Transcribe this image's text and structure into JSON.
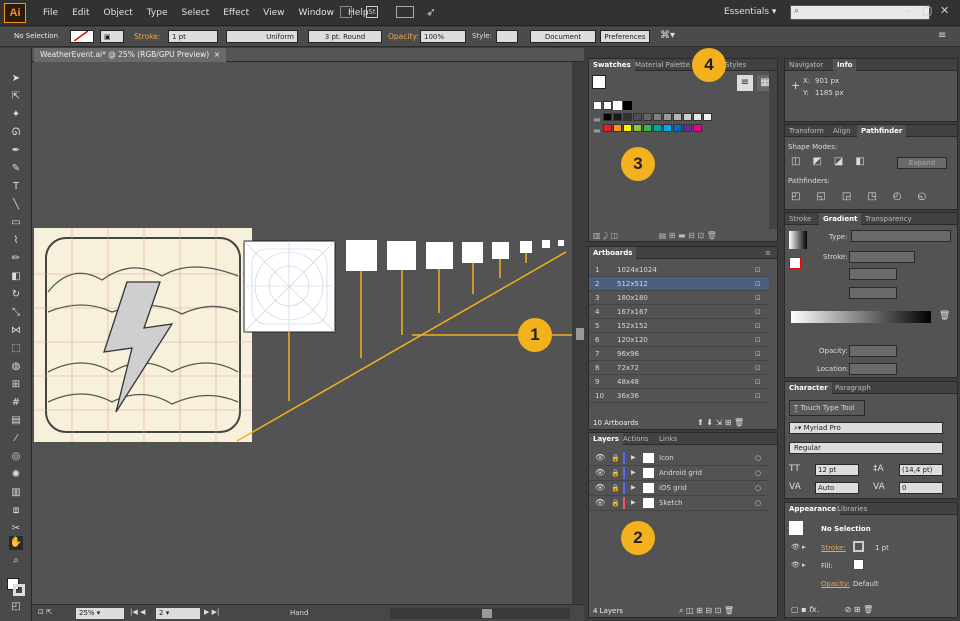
{
  "app": {
    "logo": "Ai"
  },
  "menu": [
    "File",
    "Edit",
    "Object",
    "Type",
    "Select",
    "Effect",
    "View",
    "Window",
    "Help"
  ],
  "workspace": "Essentials",
  "control_bar": {
    "selection": "No Selection",
    "stroke_label": "Stroke:",
    "stroke_value": "1 pt",
    "profile": "Uniform",
    "brush": "3 pt. Round",
    "opacity_label": "Opacity:",
    "opacity_value": "100%",
    "style_label": "Style:",
    "doc_setup": "Document Setup",
    "preferences": "Preferences"
  },
  "document_tab": "WeatherEvent.ai* @ 25% (RGB/GPU Preview)",
  "status_bar": {
    "zoom": "25%",
    "artboard": "2",
    "tool": "Hand"
  },
  "swatches_panel": {
    "tabs": [
      "Swatches",
      "Material Palette",
      "Styles"
    ],
    "row_grays": [
      "#000000",
      "#1a1a1a",
      "#333333",
      "#4d4d4d",
      "#666666",
      "#808080",
      "#999999",
      "#b3b3b3",
      "#cccccc",
      "#e6e6e6",
      "#f2f2f2"
    ],
    "row_colors": [
      "#ed1c24",
      "#f7941d",
      "#fff200",
      "#8dc63f",
      "#39b54a",
      "#00a99d",
      "#00aeef",
      "#0072bc",
      "#662d91",
      "#ec008c"
    ]
  },
  "artboards_panel": {
    "title": "Artboards",
    "items": [
      {
        "num": "1",
        "name": "1024x1024"
      },
      {
        "num": "2",
        "name": "512x512"
      },
      {
        "num": "3",
        "name": "180x180"
      },
      {
        "num": "4",
        "name": "167x167"
      },
      {
        "num": "5",
        "name": "152x152"
      },
      {
        "num": "6",
        "name": "120x120"
      },
      {
        "num": "7",
        "name": "96x96"
      },
      {
        "num": "8",
        "name": "72x72"
      },
      {
        "num": "9",
        "name": "48x48"
      },
      {
        "num": "10",
        "name": "36x36"
      }
    ],
    "count": "10 Artboards"
  },
  "layers_panel": {
    "tabs": [
      "Layers",
      "Actions",
      "Links"
    ],
    "layers": [
      {
        "name": "Icon",
        "color": "#4f6cf2"
      },
      {
        "name": "Android grid",
        "color": "#4f6cf2"
      },
      {
        "name": "iOS grid",
        "color": "#4f6cf2"
      },
      {
        "name": "Sketch",
        "color": "#f25a5a"
      }
    ],
    "count": "4 Layers"
  },
  "navigator_panel": {
    "tabs": [
      "Navigator",
      "Info"
    ],
    "x_label": "X:",
    "x_value": "901 px",
    "y_label": "Y:",
    "y_value": "1185 px"
  },
  "pathfinder_panel": {
    "tabs": [
      "Transform",
      "Align",
      "Pathfinder"
    ],
    "shape_modes": "Shape Modes:",
    "pathfinders": "Pathfinders:",
    "expand": "Expand"
  },
  "gradient_panel": {
    "tabs": [
      "Stroke",
      "Gradient",
      "Transparency"
    ],
    "type_label": "Type:",
    "stroke_label": "Stroke:",
    "opacity_label": "Opacity:",
    "location_label": "Location:"
  },
  "character_panel": {
    "tabs": [
      "Character",
      "Paragraph"
    ],
    "touch_type": "Touch Type Tool",
    "font": "Myriad Pro",
    "style": "Regular",
    "size": "12 pt",
    "leading": "(14,4 pt)",
    "tracking": "Auto",
    "kerning": "0"
  },
  "appearance_panel": {
    "tabs": [
      "Appearance",
      "Libraries"
    ],
    "title": "No Selection",
    "stroke_label": "Stroke:",
    "stroke_value": "1 pt",
    "fill_label": "Fill:",
    "opacity_label": "Opacity:",
    "opacity_value": "Default"
  },
  "callouts": [
    "1",
    "2",
    "3",
    "4"
  ],
  "colors": {
    "callout": "#f2b11d",
    "accent": "#f7941d",
    "selected_row": "#4a5e80"
  }
}
